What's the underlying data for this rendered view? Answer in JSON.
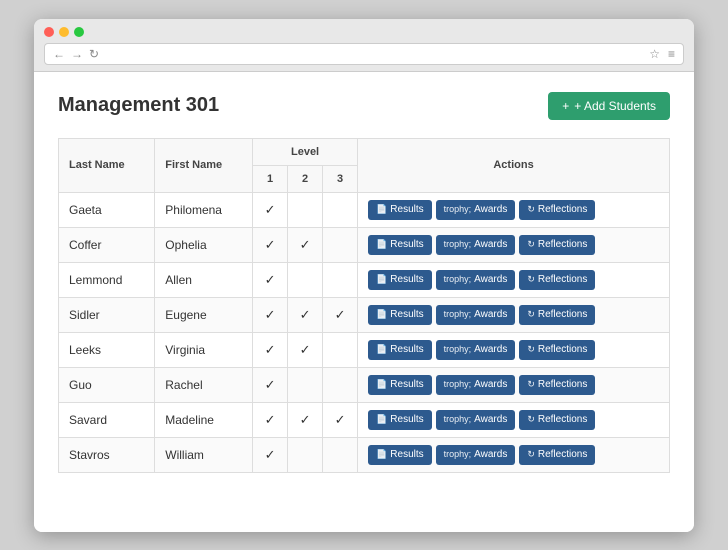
{
  "browser": {
    "back_icon": "←",
    "forward_icon": "→",
    "refresh_icon": "↻",
    "star_icon": "☆",
    "menu_icon": "≡"
  },
  "page": {
    "title": "Management 301",
    "add_students_label": "+ Add Students"
  },
  "table": {
    "headers": {
      "last_name": "Last Name",
      "first_name": "First Name",
      "level": "Level",
      "level_1": "1",
      "level_2": "2",
      "level_3": "3",
      "actions": "Actions"
    },
    "buttons": {
      "results": "Results",
      "awards": "Awards",
      "reflections": "Reflections"
    },
    "rows": [
      {
        "last": "Gaeta",
        "first": "Philomena",
        "l1": true,
        "l2": false,
        "l3": false
      },
      {
        "last": "Coffer",
        "first": "Ophelia",
        "l1": true,
        "l2": true,
        "l3": false
      },
      {
        "last": "Lemmond",
        "first": "Allen",
        "l1": true,
        "l2": false,
        "l3": false
      },
      {
        "last": "Sidler",
        "first": "Eugene",
        "l1": true,
        "l2": true,
        "l3": true
      },
      {
        "last": "Leeks",
        "first": "Virginia",
        "l1": true,
        "l2": true,
        "l3": false
      },
      {
        "last": "Guo",
        "first": "Rachel",
        "l1": true,
        "l2": false,
        "l3": false
      },
      {
        "last": "Savard",
        "first": "Madeline",
        "l1": true,
        "l2": true,
        "l3": true
      },
      {
        "last": "Stavros",
        "first": "William",
        "l1": true,
        "l2": false,
        "l3": false
      }
    ]
  }
}
